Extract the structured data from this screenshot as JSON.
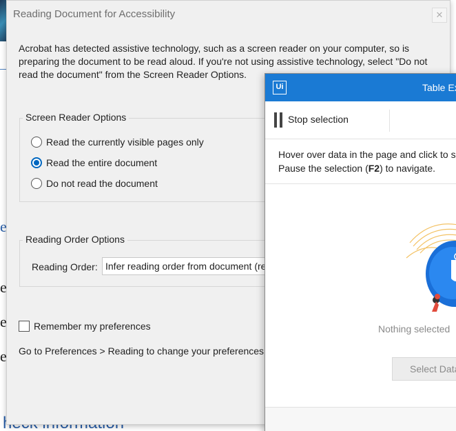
{
  "background": {
    "bottom_link_text": "heck information",
    "stray_letters": [
      "e",
      "e",
      "e",
      "e"
    ]
  },
  "dialog": {
    "title": "Reading Document for Accessibility",
    "close_glyph": "✕",
    "body_text": "Acrobat has detected assistive technology, such as a screen reader on your computer, so is preparing the document to be read aloud. If you're not using assistive technology, select \"Do not read the document\" from the Screen Reader Options.",
    "screen_reader_options": {
      "title": "Screen Reader Options",
      "options": [
        {
          "label": "Read the currently visible pages only",
          "checked": false
        },
        {
          "label": "Read the entire document",
          "checked": true
        },
        {
          "label": "Do not read the document",
          "checked": false
        }
      ]
    },
    "reading_order_options": {
      "title": "Reading Order Options",
      "reading_order_label": "Reading Order:",
      "reading_order_value": "Infer reading order from document (recommended)"
    },
    "remember_label": "Remember my preferences",
    "remember_checked": false,
    "footer_text": "Go to Preferences > Reading to change your preferences anytime."
  },
  "table_extraction": {
    "logo": "Ui",
    "title": "Table Extraction",
    "stop_selection_label": "Stop selection",
    "instructions_line1": "Hover over data in the page and click to select.",
    "instructions_line2_pre": "Pause the selection (",
    "instructions_key": "F2",
    "instructions_line2_post": ") to navigate.",
    "empty_state": "Nothing selected",
    "select_button": "Select Data",
    "accent_color": "#1a7ad4"
  }
}
